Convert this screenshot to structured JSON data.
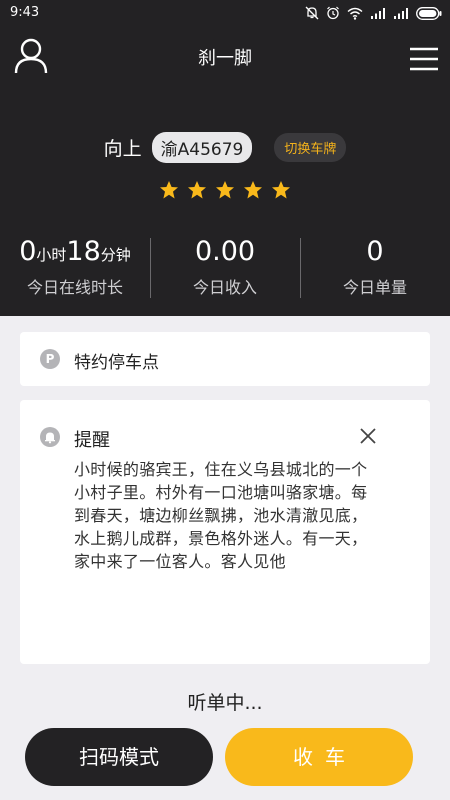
{
  "status_bar": {
    "time": "9:43"
  },
  "header": {
    "title": "刹一脚",
    "driver_name": "向上",
    "plate": "渝A45679",
    "switch_plate_label": "切换车牌",
    "rating_stars": 5
  },
  "stats": {
    "online_hours": "0",
    "hours_unit": "小时",
    "online_minutes": "18",
    "minutes_unit": "分钟",
    "online_label": "今日在线时长",
    "income_value": "0.00",
    "income_label": "今日收入",
    "orders_value": "0",
    "orders_label": "今日单量"
  },
  "parking": {
    "icon_letter": "P",
    "label": "特约停车点"
  },
  "reminder": {
    "title": "提醒",
    "body": "小时候的骆宾王，住在义乌县城北的一个小村子里。村外有一口池塘叫骆家塘。每到春天，塘边柳丝飘拂，池水清澈见底，水上鹅儿成群，景色格外迷人。有一天，家中来了一位客人。客人见他"
  },
  "status_text": "听单中...",
  "buttons": {
    "scan": "扫码模式",
    "close_car": "收车"
  },
  "colors": {
    "header_bg": "#232224",
    "accent": "#f9b91b",
    "page_bg": "#efeef2"
  }
}
